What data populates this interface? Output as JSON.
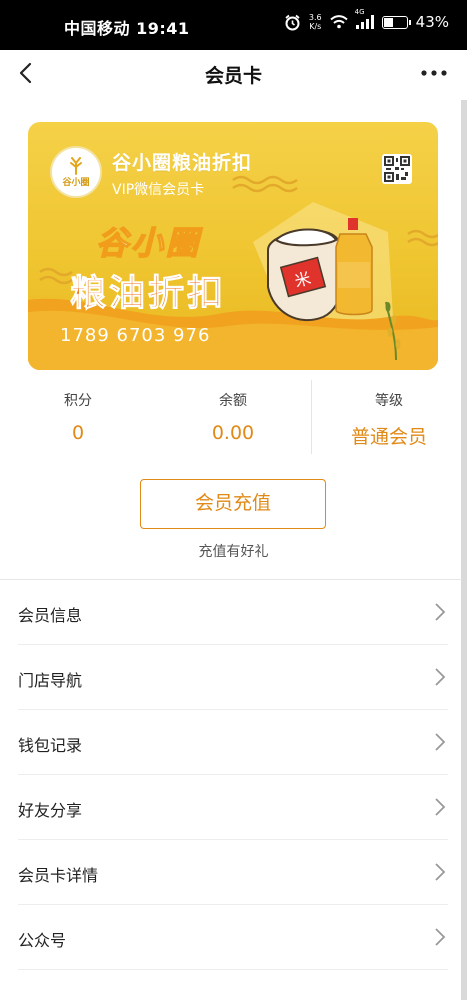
{
  "status_bar": {
    "carrier": "中国移动",
    "time": "19:41",
    "speed_value": "3.6",
    "speed_unit": "K/s",
    "network": "4G",
    "battery": "43%",
    "battery_level": 0.43
  },
  "header": {
    "title": "会员卡"
  },
  "card": {
    "brand": "谷小圈粮油折扣",
    "subtitle": "VIP微信会员卡",
    "logo_text": "谷小圈",
    "banner_line1": "谷小圈",
    "banner_line2": "粮油折扣",
    "bag_label": "米",
    "number": "1789 6703 976",
    "colors": {
      "card_top": "#f5d148",
      "card_bottom": "#e9b821",
      "banner_orange": "#f07213"
    }
  },
  "stats": [
    {
      "label": "积分",
      "value": "0"
    },
    {
      "label": "余额",
      "value": "0.00"
    },
    {
      "label": "等级",
      "value": "普通会员"
    }
  ],
  "recharge": {
    "button_label": "会员充值",
    "note": "充值有好礼"
  },
  "menu": [
    {
      "label": "会员信息"
    },
    {
      "label": "门店导航"
    },
    {
      "label": "钱包记录"
    },
    {
      "label": "好友分享"
    },
    {
      "label": "会员卡详情"
    },
    {
      "label": "公众号"
    }
  ],
  "accent_color": "#e08a17",
  "icons": {
    "back": "chevron-left-icon",
    "more": "more-dots-icon",
    "menu_arrow": "chevron-right-icon",
    "qr": "qr-code-icon"
  }
}
